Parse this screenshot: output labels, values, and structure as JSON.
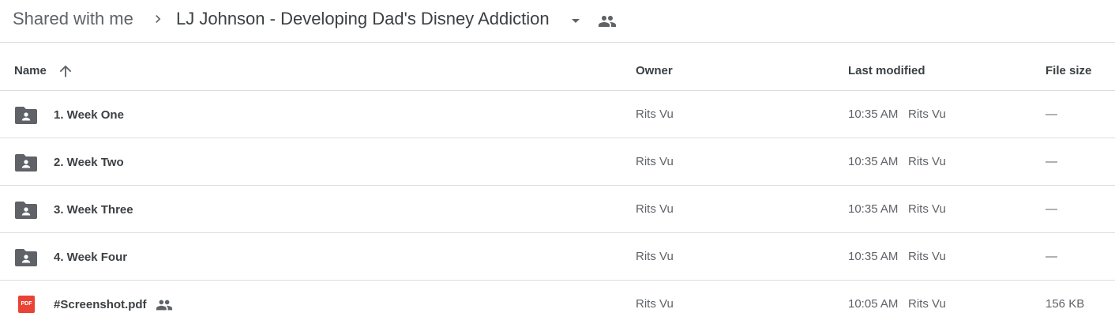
{
  "breadcrumb": {
    "root": "Shared with me",
    "current": "LJ Johnson - Developing Dad's Disney Addiction"
  },
  "columns": {
    "name": "Name",
    "owner": "Owner",
    "last_modified": "Last modified",
    "file_size": "File size"
  },
  "sort": {
    "column": "Name",
    "direction": "ascending"
  },
  "rows": [
    {
      "icon": "shared-folder-icon",
      "name": "1. Week One",
      "owner": "Rits Vu",
      "modified_time": "10:35 AM",
      "modified_by": "Rits Vu",
      "size": "—"
    },
    {
      "icon": "shared-folder-icon",
      "name": "2. Week Two",
      "owner": "Rits Vu",
      "modified_time": "10:35 AM",
      "modified_by": "Rits Vu",
      "size": "—"
    },
    {
      "icon": "shared-folder-icon",
      "name": "3. Week Three",
      "owner": "Rits Vu",
      "modified_time": "10:35 AM",
      "modified_by": "Rits Vu",
      "size": "—"
    },
    {
      "icon": "shared-folder-icon",
      "name": "4. Week Four",
      "owner": "Rits Vu",
      "modified_time": "10:35 AM",
      "modified_by": "Rits Vu",
      "size": "—"
    },
    {
      "icon": "pdf-icon",
      "icon_text": "PDF",
      "name": "#Screenshot.pdf",
      "shared": true,
      "owner": "Rits Vu",
      "modified_time": "10:05 AM",
      "modified_by": "Rits Vu",
      "size": "156 KB"
    }
  ],
  "colors": {
    "pdf_red": "#ea4335",
    "icon_gray": "#5f6368",
    "divider": "#dadce0"
  }
}
